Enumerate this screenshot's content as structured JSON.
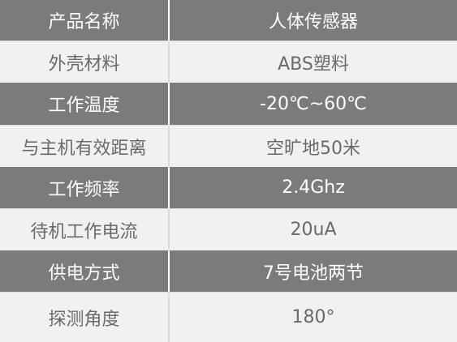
{
  "spec_table": {
    "rows": [
      {
        "label": "产品名称",
        "value": "人体传感器"
      },
      {
        "label": "外壳材料",
        "value": "ABS塑料"
      },
      {
        "label": "工作温度",
        "value": "-20℃~60℃"
      },
      {
        "label": "与主机有效距离",
        "value": "空旷地50米"
      },
      {
        "label": "工作频率",
        "value": "2.4Ghz"
      },
      {
        "label": "待机工作电流",
        "value": "20uA"
      },
      {
        "label": "供电方式",
        "value": "7号电池两节"
      },
      {
        "label": "探测角度",
        "value": "180°"
      }
    ]
  },
  "colors": {
    "dark_row_bg": "#7b7b7b",
    "light_row_bg": "#f1f1f1",
    "dark_row_text": "#ffffff",
    "light_row_text": "#6a6a6a"
  }
}
